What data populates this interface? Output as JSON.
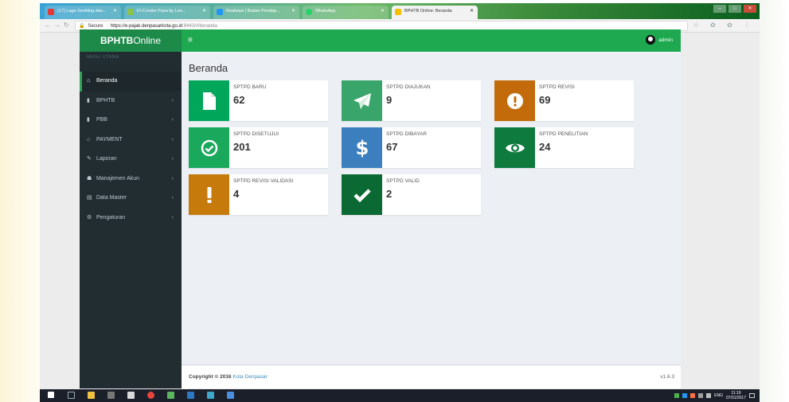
{
  "browser": {
    "tabs": [
      {
        "label": "(17) Laga Sentiling dan...",
        "color": "#e53935"
      },
      {
        "label": "El-Condor Pasa by Leo...",
        "color": "#8bc34a"
      },
      {
        "label": "Realisasi | Badan Pendap...",
        "color": "#2196f3"
      },
      {
        "label": "WhatsApp",
        "color": "#25d366"
      },
      {
        "label": "BPHTB Online: Beranda",
        "color": "#f6c000"
      }
    ],
    "secure_label": "Secure",
    "url_host": "https://e-pajak.denpasarkota.go.id",
    "url_rest": ":8443/#/beranda",
    "toolbar_icons": "☆ ✿ ✿ ⋮"
  },
  "app": {
    "brand_bold": "BPHTB",
    "brand_light": "Online",
    "menu_header": "MENU UTAMA",
    "menu": [
      {
        "label": "Beranda",
        "icon": "⌂",
        "icon_name": "dashboard-icon"
      },
      {
        "label": "BPHTB",
        "icon": "▮",
        "icon_name": "files-icon"
      },
      {
        "label": "PBB",
        "icon": "▮",
        "icon_name": "files-icon"
      },
      {
        "label": "PAYMENT",
        "icon": "⌂",
        "icon_name": "bank-icon"
      },
      {
        "label": "Laporan",
        "icon": "✎",
        "icon_name": "report-icon"
      },
      {
        "label": "Manajemen Akun",
        "icon": "☗",
        "icon_name": "users-icon"
      },
      {
        "label": "Data Master",
        "icon": "▤",
        "icon_name": "database-icon"
      },
      {
        "label": "Pengaturan",
        "icon": "⚙",
        "icon_name": "cogs-icon"
      }
    ],
    "hamburger": "≡",
    "user_name": "admin",
    "page_title": "Beranda",
    "boxes": [
      {
        "label": "SPTPD BARU",
        "value": "62",
        "color": "#00a65a",
        "icon": "file"
      },
      {
        "label": "SPTPD DIAJUKAN",
        "value": "9",
        "color": "#3aa56a",
        "icon": "send"
      },
      {
        "label": "SPTPD REVISI",
        "value": "69",
        "color": "#c36b0a",
        "icon": "exclamation-circle"
      },
      {
        "label": "SPTPD DISETUJUI",
        "value": "201",
        "color": "#19a85c",
        "icon": "check-circle"
      },
      {
        "label": "SPTPD DIBAYAR",
        "value": "67",
        "color": "#3c7fbf",
        "icon": "dollar"
      },
      {
        "label": "SPTPD PENELITIAN",
        "value": "24",
        "color": "#0e7a3e",
        "icon": "eye"
      },
      {
        "label": "SPTPD REVISI VALIDASI",
        "value": "4",
        "color": "#c77a0c",
        "icon": "exclamation"
      },
      {
        "label": "SPTPD VALID",
        "value": "2",
        "color": "#0b6a33",
        "icon": "check"
      }
    ],
    "footer_copy": "Copyright © 2016",
    "footer_link": "Kota Denpasar",
    "version": "v1.6.3"
  },
  "taskbar": {
    "lang": "ENG",
    "time": "11:19",
    "date": "07/31/2017"
  }
}
